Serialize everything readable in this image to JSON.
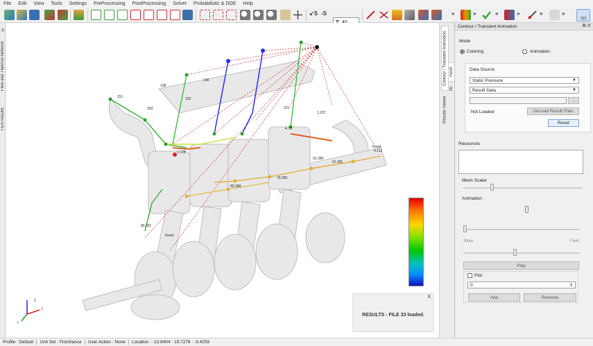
{
  "menu": [
    "File",
    "Edit",
    "View",
    "Tools",
    "Settings",
    "PreProcessing",
    "PostProcessing",
    "Solver",
    "Probabilistic & DOE",
    "Help"
  ],
  "toolbar": {
    "tess_value": "40",
    "node_label": "123",
    "chevron": "»"
  },
  "left_tabs": [
    "FEA Results",
    "Flow and Thermal Network"
  ],
  "mid_tabs": [
    "Contour / Transient Animation",
    "Results Viewer",
    "mesh",
    "flo"
  ],
  "viewport": {
    "node_labels": [
      "138",
      "130",
      "203",
      "120",
      "151",
      "115",
      "1.237",
      "Fixed",
      "91.390",
      "91.391",
      "70.290",
      "80.289",
      "80.291",
      "Fixed",
      "4.73",
      "4.113",
      "1.128"
    ],
    "result_message": "RESULTS - FILE 33 loaded.",
    "close_glyph": "X",
    "axes": {
      "x": "X",
      "y": "Y",
      "z": "Z"
    },
    "colors": {
      "accent": "#cc0000",
      "bg": "#ffffff"
    }
  },
  "panel": {
    "title": "Contour / Transient Animation",
    "title_buttons": "⧉ ✕",
    "mode_label": "Mode",
    "mode_options": [
      "Coloring",
      "Animation"
    ],
    "mode_selected": "Coloring",
    "data_source_label": "Data Source",
    "variable": "Static Pressure",
    "result_type": "Result Data",
    "file_status": "Not Loaded",
    "unload_label": "UnLoad Result Files",
    "reset_label": "Reset",
    "browse_label": "...",
    "resources_label": "Resources",
    "mesh_scaler_label": "Mesh Scaler",
    "animation_label": "Animation",
    "slow_label": "Slow",
    "fast_label": "Fast",
    "play_label": "Play",
    "plot_label": "Plot",
    "plot_value": "0",
    "add_label": "Add",
    "remove_label": "Remove"
  },
  "status": {
    "profile": "Profile : Default",
    "unit_set": "Unit Set : Floinhance",
    "user_action": "User Action : None",
    "location": "Location : -13.8404 : 19.7278 : -3.4259"
  }
}
